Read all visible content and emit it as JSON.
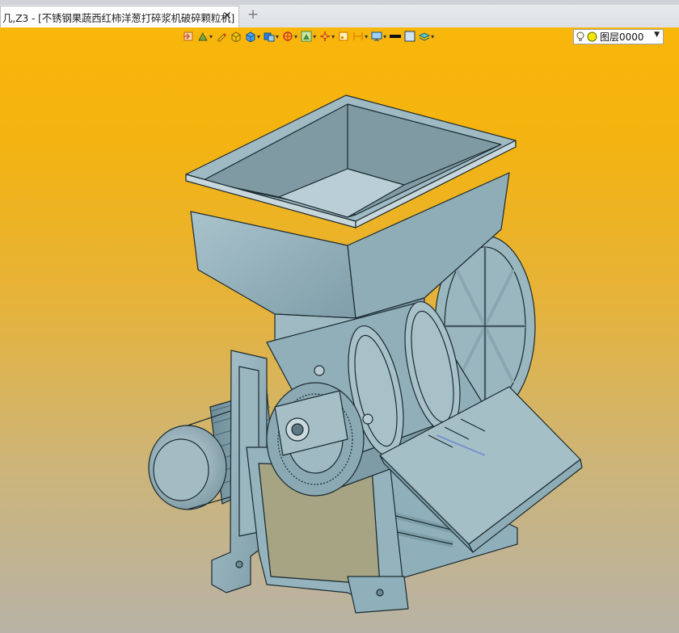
{
  "window": {
    "tab_title": "几,Z3 - [不锈钢果蔬西红柿洋葱打碎浆机破碎颗粒机]",
    "close_glyph": "✕",
    "add_glyph": "+"
  },
  "toolbar": {
    "buttons": [
      {
        "name": "import-icon",
        "color": "#d9534f"
      },
      {
        "name": "paint-icon",
        "color": "#7fa63a"
      },
      {
        "name": "pencil-icon",
        "color": "#c9302c"
      },
      {
        "name": "box-yellow-icon",
        "color": "#f0c419"
      },
      {
        "name": "box-blue-icon",
        "color": "#2a7fd4"
      },
      {
        "name": "shade-icon",
        "color": "#2a7fd4"
      },
      {
        "name": "orbit-icon",
        "color": "#c9302c"
      },
      {
        "name": "view-icon",
        "color": "#4a8a3a"
      },
      {
        "name": "origin-icon",
        "color": "#c9302c"
      },
      {
        "name": "frame-icon",
        "color": "#e08a00"
      },
      {
        "name": "dimension-icon",
        "color": "#e08a00"
      },
      {
        "name": "display-icon",
        "color": "#2a7fd4"
      },
      {
        "name": "line-color-icon",
        "color": "#111111"
      },
      {
        "name": "fill-color-icon",
        "color": "#cfe3f5"
      },
      {
        "name": "layers-icon",
        "color": "#3aa0a0"
      }
    ],
    "layer": {
      "label": "图层0000",
      "bulb_color": "#f3e600"
    }
  },
  "viewport": {
    "model_name": "machine-3d-model",
    "body_color": "#8fb0bb",
    "edge_color": "#1b2a30"
  }
}
